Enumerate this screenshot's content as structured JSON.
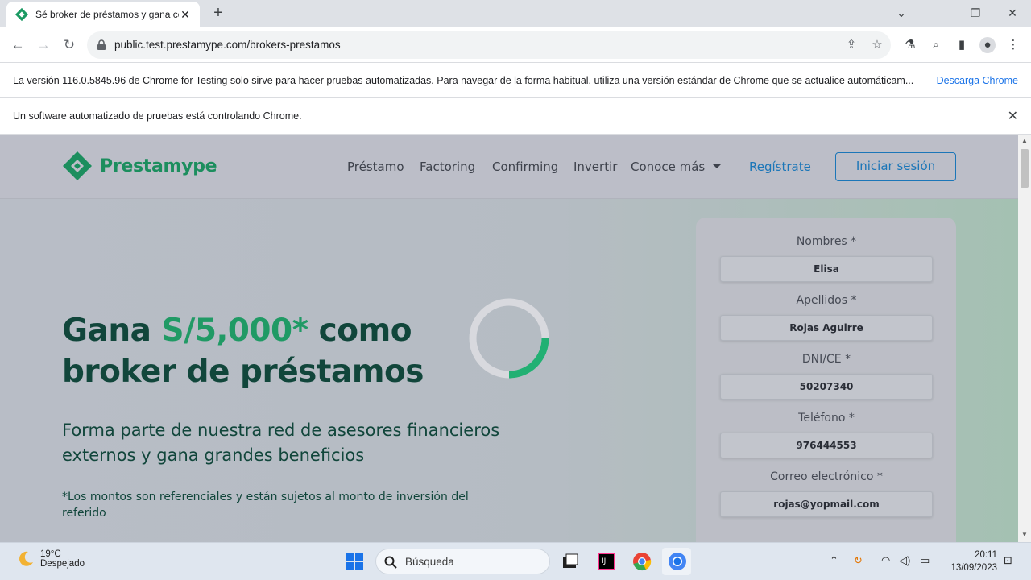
{
  "browser": {
    "tab_title": "Sé broker de préstamos y gana con Prestamype",
    "url": "public.test.prestamype.com/brokers-prestamos"
  },
  "infobar": {
    "message": "La versión 116.0.5845.96 de Chrome for Testing solo sirve para hacer pruebas automatizadas. Para navegar de la forma habitual, utiliza una versión estándar de Chrome que se actualice automáticam...",
    "link": "Descarga Chrome",
    "automation_message": "Un software automatizado de pruebas está controlando Chrome."
  },
  "site": {
    "brand": "Prestamype",
    "nav": [
      "Préstamo",
      "Factoring",
      "Confirming",
      "Invertir",
      "Conoce más"
    ],
    "register": "Regístrate",
    "login": "Iniciar sesión"
  },
  "hero": {
    "title_pre": "Gana ",
    "title_accent": "S/5,000*",
    "title_post": " como",
    "title_line2": "broker de préstamos",
    "subtitle": "Forma parte de nuestra red de asesores financieros externos y gana grandes beneficios",
    "note": "*Los montos son referenciales y están sujetos al monto de inversión del referido"
  },
  "form": {
    "fields": [
      {
        "label": "Nombres *",
        "value": "Elisa"
      },
      {
        "label": "Apellidos *",
        "value": "Rojas Aguirre"
      },
      {
        "label": "DNI/CE *",
        "value": "50207340"
      },
      {
        "label": "Teléfono *",
        "value": "976444553"
      },
      {
        "label": "Correo electrónico *",
        "value": "rojas@yopmail.com"
      }
    ]
  },
  "taskbar": {
    "temperature": "19°C",
    "weather": "Despejado",
    "search": "Búsqueda",
    "time": "20:11",
    "date": "13/09/2023"
  },
  "colors": {
    "brand_green": "#1b9a63",
    "accent_green": "#20a86a",
    "hero_text": "#0f4a3c",
    "link_blue": "#1a7fc7"
  }
}
